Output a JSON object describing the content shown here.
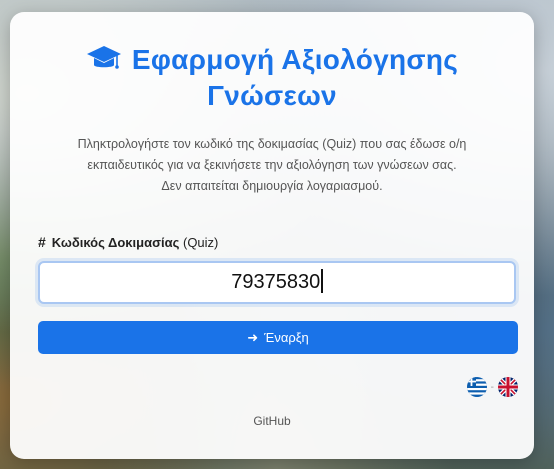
{
  "header": {
    "title_line1": "Εφαρμογή Αξιολόγησης",
    "title_line2": "Γνώσεων",
    "icon": "graduation-cap-icon",
    "title_color": "#1a73e8"
  },
  "description": {
    "line1": "Πληκτρολογήστε τον κωδικό της δοκιμασίας (Quiz) που σας έδωσε ο/η",
    "line2": "εκπαιδευτικός για να ξεκινήσετε την αξιολόγηση των γνώσεων σας.",
    "line3": "Δεν απαιτείται δημιουργία λογαριασμού."
  },
  "form": {
    "label_icon": "#",
    "label_bold": "Κωδικός Δοκιμασίας",
    "label_rest": "(Quiz)",
    "code_value": "79375830",
    "start_icon": "arrow-right-icon",
    "start_label": "Έναρξη",
    "accent": "#1a73e8"
  },
  "languages": {
    "items": [
      {
        "code": "el",
        "icon": "greek-flag-icon"
      },
      {
        "code": "en",
        "icon": "uk-flag-icon"
      }
    ],
    "separator": "-"
  },
  "footer": {
    "github_label": "GitHub"
  }
}
